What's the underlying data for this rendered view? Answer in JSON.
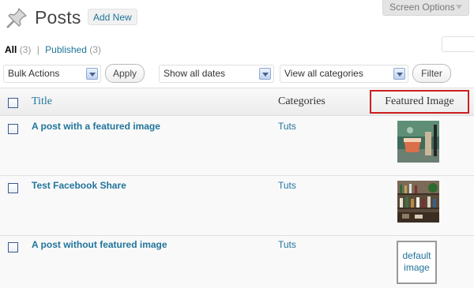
{
  "header": {
    "title": "Posts",
    "add_new_label": "Add New",
    "screen_options_label": "Screen Options"
  },
  "views": {
    "all_label": "All",
    "all_count": "(3)",
    "separator": "|",
    "published_label": "Published",
    "published_count": "(3)"
  },
  "filters": {
    "bulk_actions": "Bulk Actions",
    "apply_label": "Apply",
    "dates": "Show all dates",
    "categories": "View all categories",
    "filter_label": "Filter"
  },
  "table": {
    "columns": {
      "title": "Title",
      "categories": "Categories",
      "featured_image": "Featured Image"
    },
    "rows": [
      {
        "title": "A post with a featured image",
        "category": "Tuts",
        "image": "photo-drinks"
      },
      {
        "title": "Test Facebook Share",
        "category": "Tuts",
        "image": "photo-bottles"
      },
      {
        "title": "A post without featured image",
        "category": "Tuts",
        "image": "default",
        "default_label": "default image"
      }
    ]
  },
  "colors": {
    "link": "#21759b",
    "highlight_border": "#cc1f1f"
  }
}
